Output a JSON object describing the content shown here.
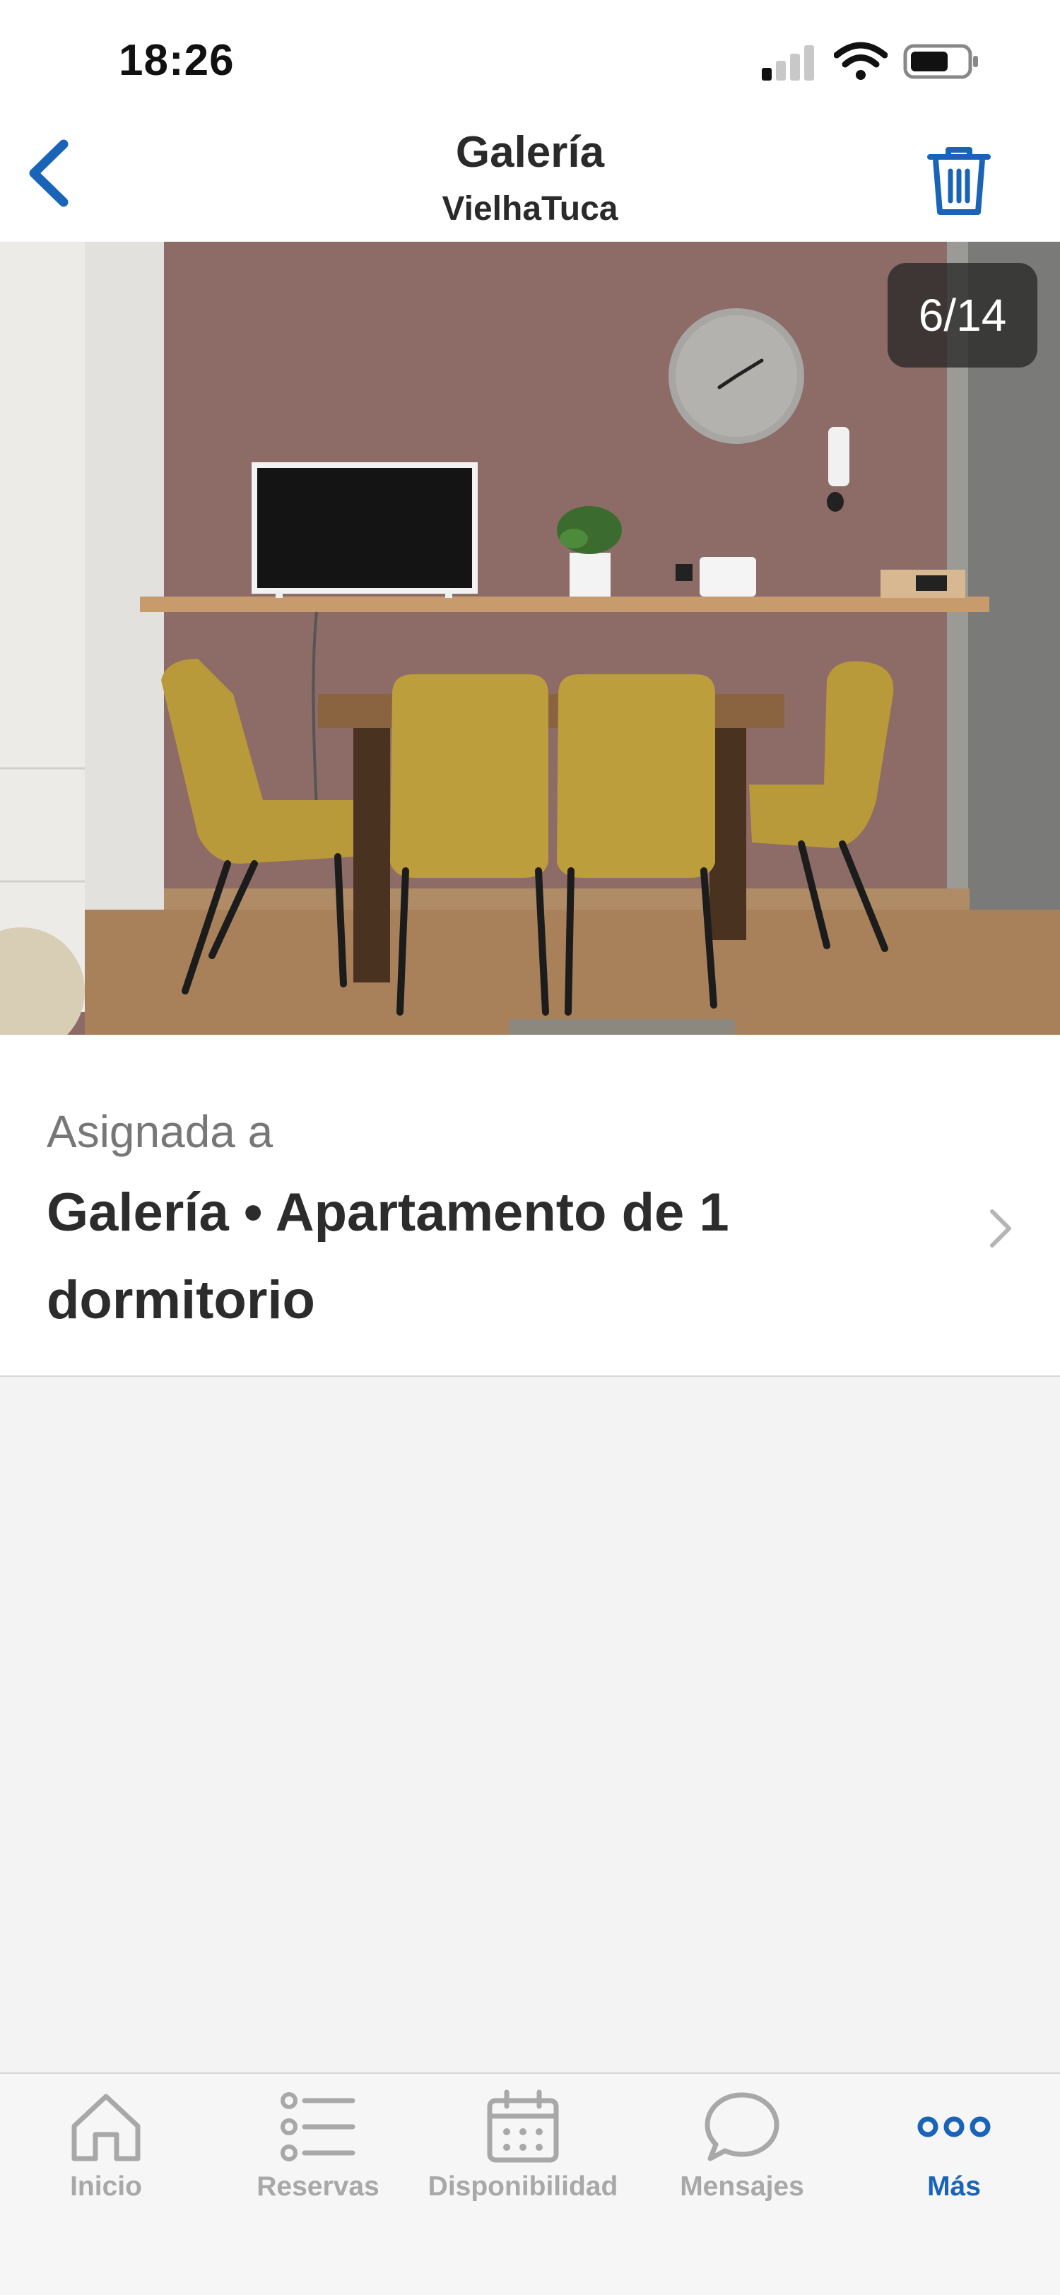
{
  "status_bar": {
    "time": "18:26"
  },
  "header": {
    "title": "Galería",
    "subtitle": "VielhaTuca"
  },
  "gallery": {
    "counter": "6/14"
  },
  "assignment": {
    "label": "Asignada a",
    "value": "Galería • Apartamento de 1 dormitorio"
  },
  "tabs": [
    {
      "label": "Inicio",
      "icon": "home-icon",
      "active": false
    },
    {
      "label": "Reservas",
      "icon": "list-icon",
      "active": false
    },
    {
      "label": "Disponibilidad",
      "icon": "calendar-icon",
      "active": false
    },
    {
      "label": "Mensajes",
      "icon": "chat-icon",
      "active": false
    },
    {
      "label": "Más",
      "icon": "more-icon",
      "active": true
    }
  ],
  "colors": {
    "accent": "#1a64b8",
    "inactive": "#a8a8a8",
    "wall": "#8d6b66"
  }
}
